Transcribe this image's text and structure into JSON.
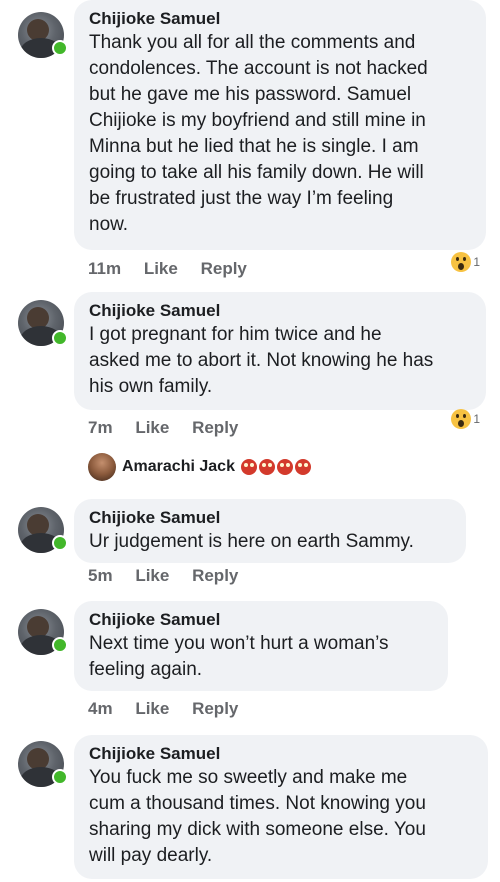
{
  "comments": [
    {
      "author": "Chijioke Samuel",
      "lines": [
        "Thank you all for all the comments and",
        "condolences. The account is not hacked",
        "but he gave me his password. Samuel",
        "Chijioke is my boyfriend and still mine in",
        "Minna but he lied that he is single. I am",
        "going to take all his family down. He will",
        "be frustrated just the way I’m feeling",
        "now."
      ],
      "time": "11m",
      "like": "Like",
      "reply": "Reply",
      "reaction_count": "1",
      "reaction_icon": "wow-icon"
    },
    {
      "author": "Chijioke Samuel",
      "lines": [
        "I got pregnant for him twice and he",
        "asked me to abort it. Not knowing he has",
        "his own family."
      ],
      "time": "7m",
      "like": "Like",
      "reply": "Reply",
      "reaction_count": "1",
      "reaction_icon": "wow-icon"
    },
    {
      "author": "Chijioke Samuel",
      "lines": [
        "Ur judgement is here on earth Sammy."
      ],
      "time": "5m",
      "like": "Like",
      "reply": "Reply"
    },
    {
      "author": "Chijioke Samuel",
      "lines": [
        "Next time you won’t hurt a woman’s",
        "feeling again."
      ],
      "time": "4m",
      "like": "Like",
      "reply": "Reply"
    },
    {
      "author": "Chijioke Samuel",
      "lines": [
        "You fuck me so sweetly and make me",
        "cum a thousand times. Not knowing you",
        "sharing my dick with someone else. You",
        "will pay dearly."
      ]
    }
  ],
  "reply_preview": {
    "name": "Amarachi Jack",
    "emoji_icon": "laughing-emoji-icon",
    "emoji_count": 4
  },
  "colors": {
    "bubble": "#f0f2f5",
    "online": "#42b72a",
    "meta_text": "#65676b",
    "wow": "#f7c242"
  }
}
